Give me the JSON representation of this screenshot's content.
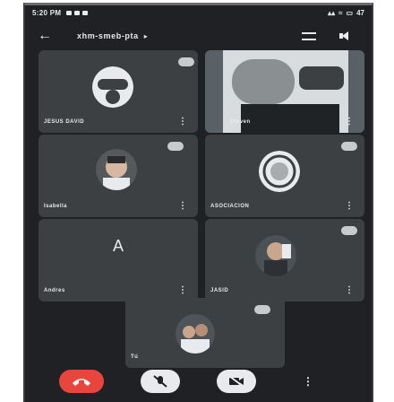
{
  "status_bar": {
    "time": "5:20 PM",
    "battery": "47"
  },
  "top_bar": {
    "meeting_code": "xhm-smeb-pta",
    "back_icon": "back-arrow-icon",
    "chevron": "▸"
  },
  "participants": [
    {
      "name": "JESUS DAVID"
    },
    {
      "name": "Steven"
    },
    {
      "name": "Isabella"
    },
    {
      "name": "ASOCIACION"
    },
    {
      "name": "Andres",
      "initial": "A"
    },
    {
      "name": "JASID"
    },
    {
      "name": "Tú"
    }
  ],
  "controls": {
    "hangup": "end-call-icon",
    "mic": "mic-off-icon",
    "camera": "camera-off-icon",
    "more": "⋮"
  },
  "colors": {
    "background": "#202124",
    "tile": "#3c4043",
    "hangup": "#e8453c"
  }
}
